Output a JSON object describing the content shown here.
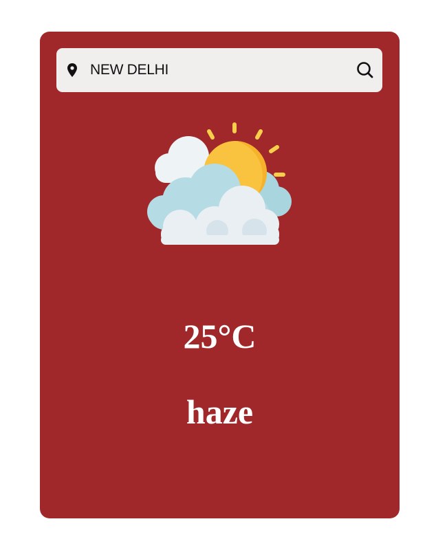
{
  "search": {
    "value": "NEW DELHI",
    "location_icon": "map-pin-icon",
    "search_icon": "search-icon"
  },
  "weather": {
    "icon": "partly-cloudy-sun-icon",
    "temperature": "25°C",
    "description": "haze"
  },
  "colors": {
    "card_background": "#a0282a",
    "search_background": "#f0efee",
    "text": "#ffffff"
  }
}
